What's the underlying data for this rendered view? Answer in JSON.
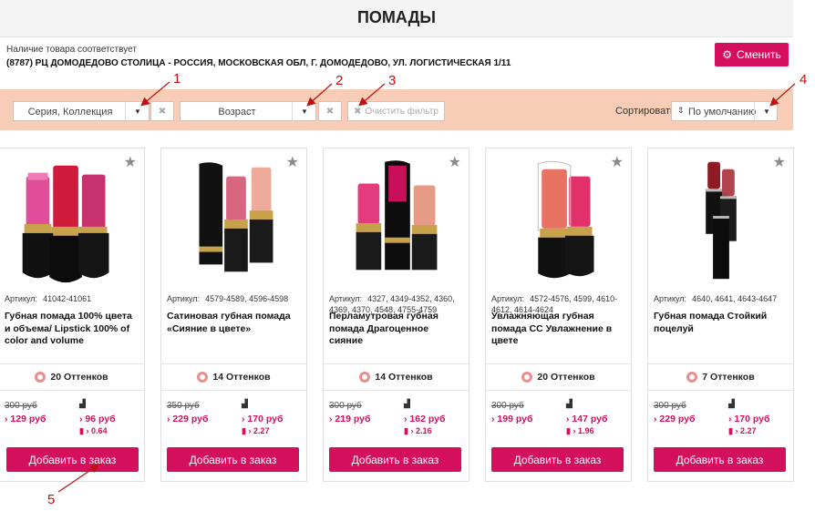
{
  "page_title": "ПОМАДЫ",
  "availability": {
    "line1": "Наличие товара соответствует",
    "line2": "(8787) РЦ ДОМОДЕДОВО СТОЛИЦА - РОССИЯ, МОСКОВСКАЯ ОБЛ, Г. ДОМОДЕДОВО, УЛ. ЛОГИСТИЧЕСКАЯ 1/11",
    "change_button": "Сменить"
  },
  "filters": {
    "series": "Серия, Коллекция",
    "age": "Возраст",
    "clear": "Очистить фильтр",
    "sort_label": "Сортировать",
    "sort_value": "По умолчанию"
  },
  "products": [
    {
      "article_label": "Артикул:",
      "article": "41042-41061",
      "name": "Губная помада 100% цвета и объема/ Lipstick 100% of color and volume",
      "shades": "20 Оттенков",
      "old_price": "300 руб",
      "new_price": "129 руб",
      "pts": "96 руб",
      "ratio": "0.64",
      "add": "Добавить в заказ"
    },
    {
      "article_label": "Артикул:",
      "article": "4579-4589, 4596-4598",
      "name": "Сатиновая губная помада «Сияние в цвете»",
      "shades": "14 Оттенков",
      "old_price": "350 руб",
      "new_price": "229 руб",
      "pts": "170 руб",
      "ratio": "2.27",
      "add": "Добавить в заказ"
    },
    {
      "article_label": "Артикул:",
      "article": "4327, 4349-4352, 4360, 4369, 4370, 4548, 4755-4759",
      "name": "Перламутровая губная помада Драгоценное сияние",
      "shades": "14 Оттенков",
      "old_price": "300 руб",
      "new_price": "219 руб",
      "pts": "162 руб",
      "ratio": "2.16",
      "add": "Добавить в заказ"
    },
    {
      "article_label": "Артикул:",
      "article": "4572-4576, 4599, 4610-4612, 4614-4624",
      "name": "Увлажняющая губная помада CC Увлажнение в цвете",
      "shades": "20 Оттенков",
      "old_price": "300 руб",
      "new_price": "199 руб",
      "pts": "147 руб",
      "ratio": "1.96",
      "add": "Добавить в заказ"
    },
    {
      "article_label": "Артикул:",
      "article": "4640, 4641, 4643-4647",
      "name": "Губная помада Стойкий поцелуй",
      "shades": "7 Оттенков",
      "old_price": "300 руб",
      "new_price": "229 руб",
      "pts": "170 руб",
      "ratio": "2.27",
      "add": "Добавить в заказ"
    }
  ],
  "annotations": [
    "1",
    "2",
    "3",
    "4",
    "5"
  ],
  "colors": {
    "accent": "#d4105c",
    "filter_bar": "#f8cdb7",
    "annotation": "#c01010"
  }
}
